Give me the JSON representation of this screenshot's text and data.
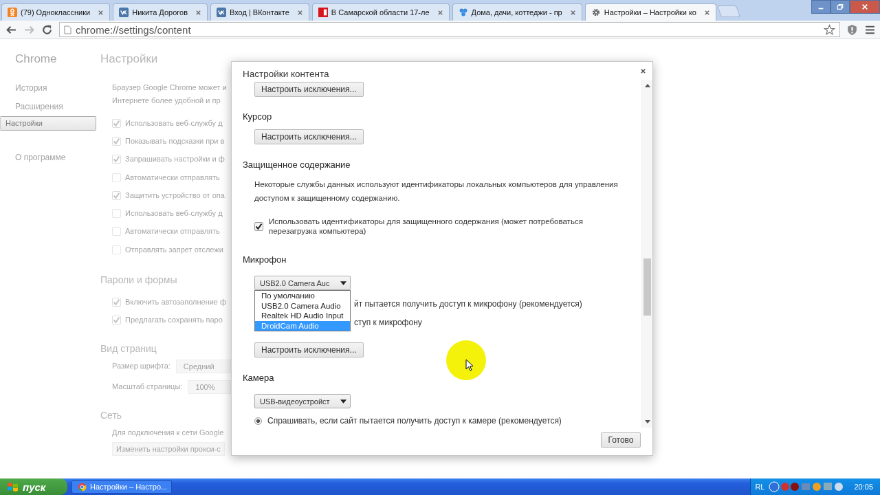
{
  "browser": {
    "tabs": [
      {
        "title": "(79) Одноклассники",
        "kind": "ok",
        "selected": false
      },
      {
        "title": "Никита Дорогов",
        "kind": "vk",
        "selected": false
      },
      {
        "title": "Вход | ВКонтакте",
        "kind": "vk",
        "selected": false
      },
      {
        "title": "В Самарской области 17-ле",
        "kind": "news",
        "selected": false
      },
      {
        "title": "Дома, дачи, коттеджи - пр",
        "kind": "dots",
        "selected": false
      },
      {
        "title": "Настройки – Настройки ко",
        "kind": "gear",
        "selected": true
      }
    ],
    "address": "chrome://settings/content"
  },
  "settings_page": {
    "brand": "Chrome",
    "nav": [
      {
        "label": "История",
        "selected": false
      },
      {
        "label": "Расширения",
        "selected": false
      },
      {
        "label": "Настройки",
        "selected": true
      },
      {
        "label": "О программе",
        "selected": false
      }
    ],
    "title": "Настройки",
    "intro": [
      "Браузер Google Chrome может и",
      "Интернете более удобной и пр"
    ],
    "privacy": [
      {
        "label": "Использовать веб-службу д",
        "checked": true
      },
      {
        "label": "Показывать подсказки при в",
        "checked": true
      },
      {
        "label": "Запрашивать настройки и ф",
        "checked": true
      },
      {
        "label": "Автоматически отправлять",
        "checked": false
      },
      {
        "label": "Защитить устройство от опа",
        "checked": true
      },
      {
        "label": "Использовать веб-службу д",
        "checked": false
      },
      {
        "label": "Автоматически отправлять",
        "checked": false
      },
      {
        "label": "Отправлять запрет отслежи",
        "checked": false
      }
    ],
    "passwords": {
      "heading": "Пароли и формы",
      "options": [
        {
          "label": "Включить автозаполнение ф",
          "checked": true
        },
        {
          "label": "Предлагать сохранять паро",
          "checked": true
        }
      ]
    },
    "appearance": {
      "heading": "Вид страниц",
      "rows": [
        {
          "label": "Размер шрифта:",
          "value": "Средний"
        },
        {
          "label": "Масштаб страницы:",
          "value": "100%"
        }
      ]
    },
    "network": {
      "heading": "Сеть",
      "text": "Для подключения к сети Google",
      "button": "Изменить настройки прокси-с"
    }
  },
  "dialog": {
    "title": "Настройки контента",
    "top_button": "Настроить исключения...",
    "cursor": {
      "heading": "Курсор",
      "button": "Настроить исключения..."
    },
    "protected_content": {
      "heading": "Защищенное содержание",
      "description": "Некоторые службы данных используют идентификаторы локальных компьютеров для управления доступом к защищенному содержанию.",
      "option": {
        "label": "Использовать идентификаторы для защищенного содержания (может потребоваться перезагрузка компьютера)",
        "checked": true
      }
    },
    "microphone": {
      "heading": "Микрофон",
      "device": "USB2.0 Camera Auc",
      "options": [
        {
          "label": "По умолчанию",
          "selected": false
        },
        {
          "label": "USB2.0 Camera Audio",
          "selected": false
        },
        {
          "label": "Realtek HD Audio Input",
          "selected": false
        },
        {
          "label": "DroidCam Audio",
          "selected": true
        }
      ],
      "choices": [
        "йт пытается получить доступ к микрофону (рекомендуется)",
        "ступ к микрофону"
      ],
      "button": "Настроить исключения..."
    },
    "camera": {
      "heading": "Камера",
      "device": "USB-видеоустройст",
      "choice": {
        "label": "Спрашивать, если сайт пытается получить доступ к камере (рекомендуется)",
        "selected": true
      }
    },
    "done_button": "Готово"
  },
  "taskbar": {
    "start": "пуск",
    "tasks": [
      "Настройки – Настро..."
    ],
    "language": "RL",
    "clock": "20:05"
  }
}
